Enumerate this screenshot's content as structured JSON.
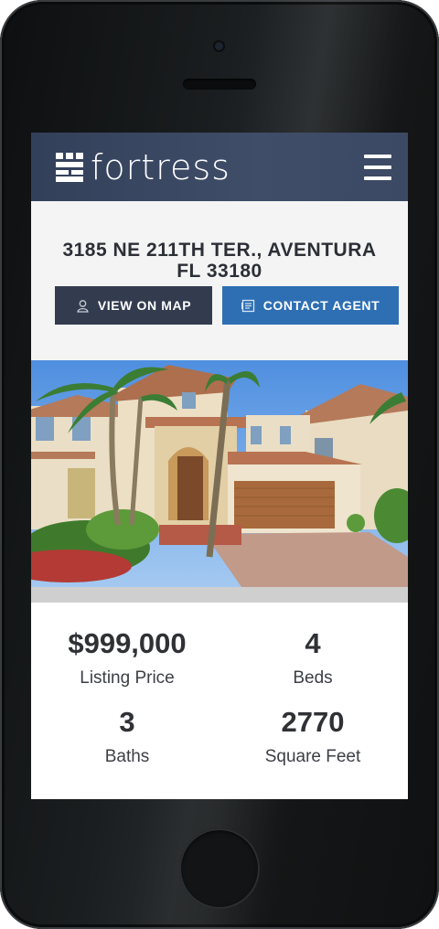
{
  "header": {
    "logo_text": "fortress",
    "logo_icon": "tower-icon",
    "menu_icon": "hamburger-menu-icon"
  },
  "listing": {
    "address_line1": "3185 NE 211TH TER., AVENTURA",
    "address_line2": "FL 33180"
  },
  "actions": {
    "view_on_map": "VIEW ON MAP",
    "view_on_map_icon": "person-pin-icon",
    "contact_agent": "CONTACT AGENT",
    "contact_agent_icon": "contact-card-icon"
  },
  "photo": {
    "icon": "house-photo"
  },
  "stats": [
    {
      "value": "$999,000",
      "label": "Listing Price"
    },
    {
      "value": "4",
      "label": "Beds"
    },
    {
      "value": "3",
      "label": "Baths"
    },
    {
      "value": "2770",
      "label": "Square Feet"
    }
  ],
  "colors": {
    "header_bg": "#3b4964",
    "map_button": "#333c4f",
    "contact_button": "#2e6fb4",
    "text_dark": "#2f3135"
  }
}
